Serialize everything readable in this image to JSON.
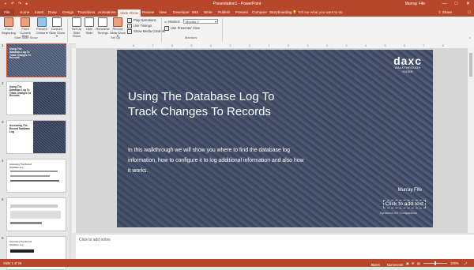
{
  "titlebar": {
    "title": "Presentation1 - PowerPoint",
    "user": "Murray Fife",
    "qat": [
      "save-icon",
      "undo-icon",
      "redo-icon",
      "start-icon"
    ],
    "controls": [
      "—",
      "□",
      "✕"
    ]
  },
  "tabs": [
    "File",
    "Home",
    "Insert",
    "Draw",
    "Design",
    "Transitions",
    "Animations",
    "Slide Show",
    "Review",
    "View",
    "Developer",
    "MIX",
    "Write",
    "Publish",
    "Present",
    "Compare",
    "Storyboarding"
  ],
  "active_tab": "Slide Show",
  "tell_me": "Tell me what you want to do",
  "share": "Share",
  "ribbon": {
    "start_show": {
      "from_beginning": "From Beginning",
      "from_current": "From Current Slide",
      "present_online": "Present Online ▾",
      "custom_show": "Custom Slide Show ▾",
      "label": "Start Slide Show"
    },
    "setup": {
      "setup_show": "Set Up Slide Show",
      "hide_slide": "Hide Slide",
      "rehearse": "Rehearse Timings",
      "record": "Record Slide Show ▾",
      "play_narrations": "Play Narrations",
      "use_timings": "Use Timings",
      "show_media": "Show Media Controls",
      "label": "Set Up"
    },
    "monitors": {
      "monitor_label": "Monitor:",
      "monitor_value": "Monitor 2",
      "presenter_view": "Use Presenter View",
      "label": "Monitors"
    }
  },
  "ruler_marks": [
    "8",
    "7",
    "6",
    "5",
    "4",
    "3",
    "2",
    "1",
    "0",
    "1",
    "2",
    "3",
    "4",
    "5",
    "6",
    "7",
    "8"
  ],
  "thumbnails": [
    {
      "num": "1",
      "title": "Using The Database Log To Track Changes To Records"
    },
    {
      "num": "2",
      "title": "Using The Database Log To Track Changes To Records"
    },
    {
      "num": "3",
      "title": "Accessing The Record Database Log"
    },
    {
      "num": "4",
      "title": "Accessing The Record Database Log"
    },
    {
      "num": "5",
      "title": ""
    },
    {
      "num": "6",
      "title": "Accessing The Record Database Log"
    }
  ],
  "slide": {
    "title": "Using The Database Log To Track Changes To Records",
    "body": "In this walkthrough we will show you where to find the database log information, how to configure it to log additional information and also how it works.",
    "logo_mark": "daxc",
    "logo_sub1": "WALKTHROUGH",
    "logo_sub2": "GUIDE",
    "author": "Murray Fife",
    "click_add": "Click to add text",
    "extra": "Dynamics AX Companions"
  },
  "notes_placeholder": "Click to add notes",
  "status": {
    "slide_info": "Slide 1 of 26",
    "notes_btn": "Notes",
    "comments_btn": "Comments",
    "zoom": "100%",
    "zoom_fraction": 0.5
  }
}
